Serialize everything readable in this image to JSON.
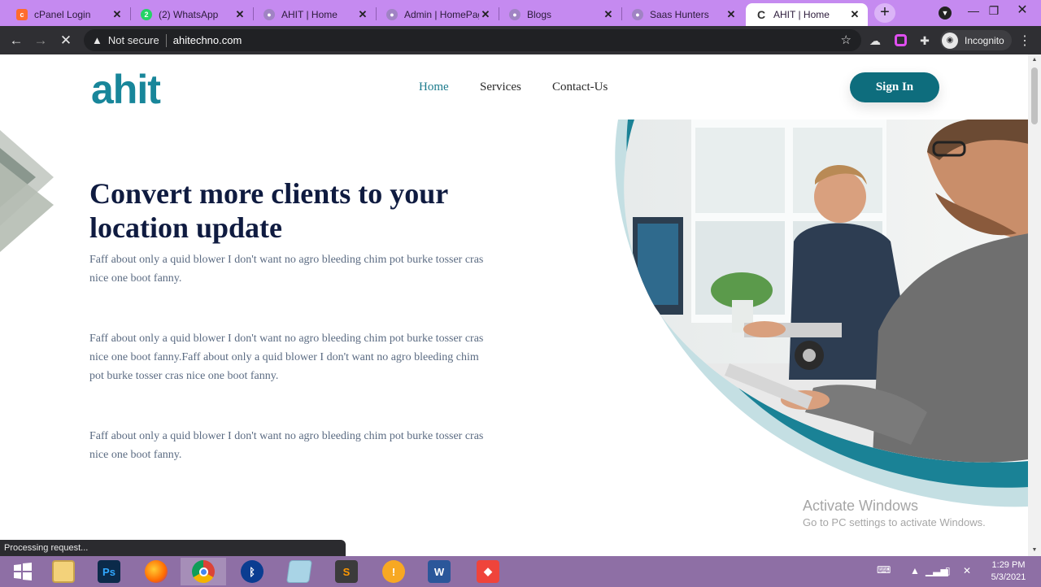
{
  "browser": {
    "tabs": [
      {
        "title": "cPanel Login",
        "icon": "cpanel-icon",
        "color": "#ff6c2c"
      },
      {
        "title": "(2) WhatsApp",
        "icon": "whatsapp-icon",
        "color": "#25d366"
      },
      {
        "title": "AHIT | Home",
        "icon": "globe-icon",
        "color": "#a083c4"
      },
      {
        "title": "Admin | HomePag",
        "icon": "globe-icon",
        "color": "#a083c4"
      },
      {
        "title": "Blogs",
        "icon": "globe-icon",
        "color": "#a083c4"
      },
      {
        "title": "Saas Hunters",
        "icon": "globe-icon",
        "color": "#a083c4"
      },
      {
        "title": "AHIT | Home",
        "icon": "loading-icon",
        "color": "#555555"
      }
    ],
    "active_tab_index": 6,
    "security_label": "Not secure",
    "url": "ahitechno.com",
    "profile_label": "Incognito",
    "status_text": "Processing request..."
  },
  "site": {
    "logo_text": "ahit",
    "nav": [
      "Home",
      "Services",
      "Contact-Us"
    ],
    "signin_label": "Sign In",
    "hero_title": "Convert more clients to your location update",
    "paragraphs": [
      "Faff about only a quid blower I don't want no agro bleeding chim pot burke tosser cras nice one boot fanny.",
      "Faff about only a quid blower I don't want no agro bleeding chim pot burke tosser cras nice one boot fanny.Faff about only a quid blower I don't want no agro bleeding chim pot burke tosser cras nice one boot fanny.",
      "Faff about only a quid blower I don't want no agro bleeding chim pot burke tosser cras nice one boot fanny."
    ],
    "accent_color": "#0e6d7d",
    "title_color": "#0f1b40"
  },
  "watermark": {
    "line1": "Activate Windows",
    "line2": "Go to PC settings to activate Windows."
  },
  "taskbar": {
    "apps": [
      "start-icon",
      "file-explorer-icon",
      "photoshop-icon",
      "firefox-icon",
      "chrome-icon",
      "bluetooth-icon",
      "notepad-icon",
      "sublime-icon",
      "avast-icon",
      "word-icon",
      "anydesk-icon"
    ],
    "time": "1:29 PM",
    "date": "5/3/2021"
  }
}
